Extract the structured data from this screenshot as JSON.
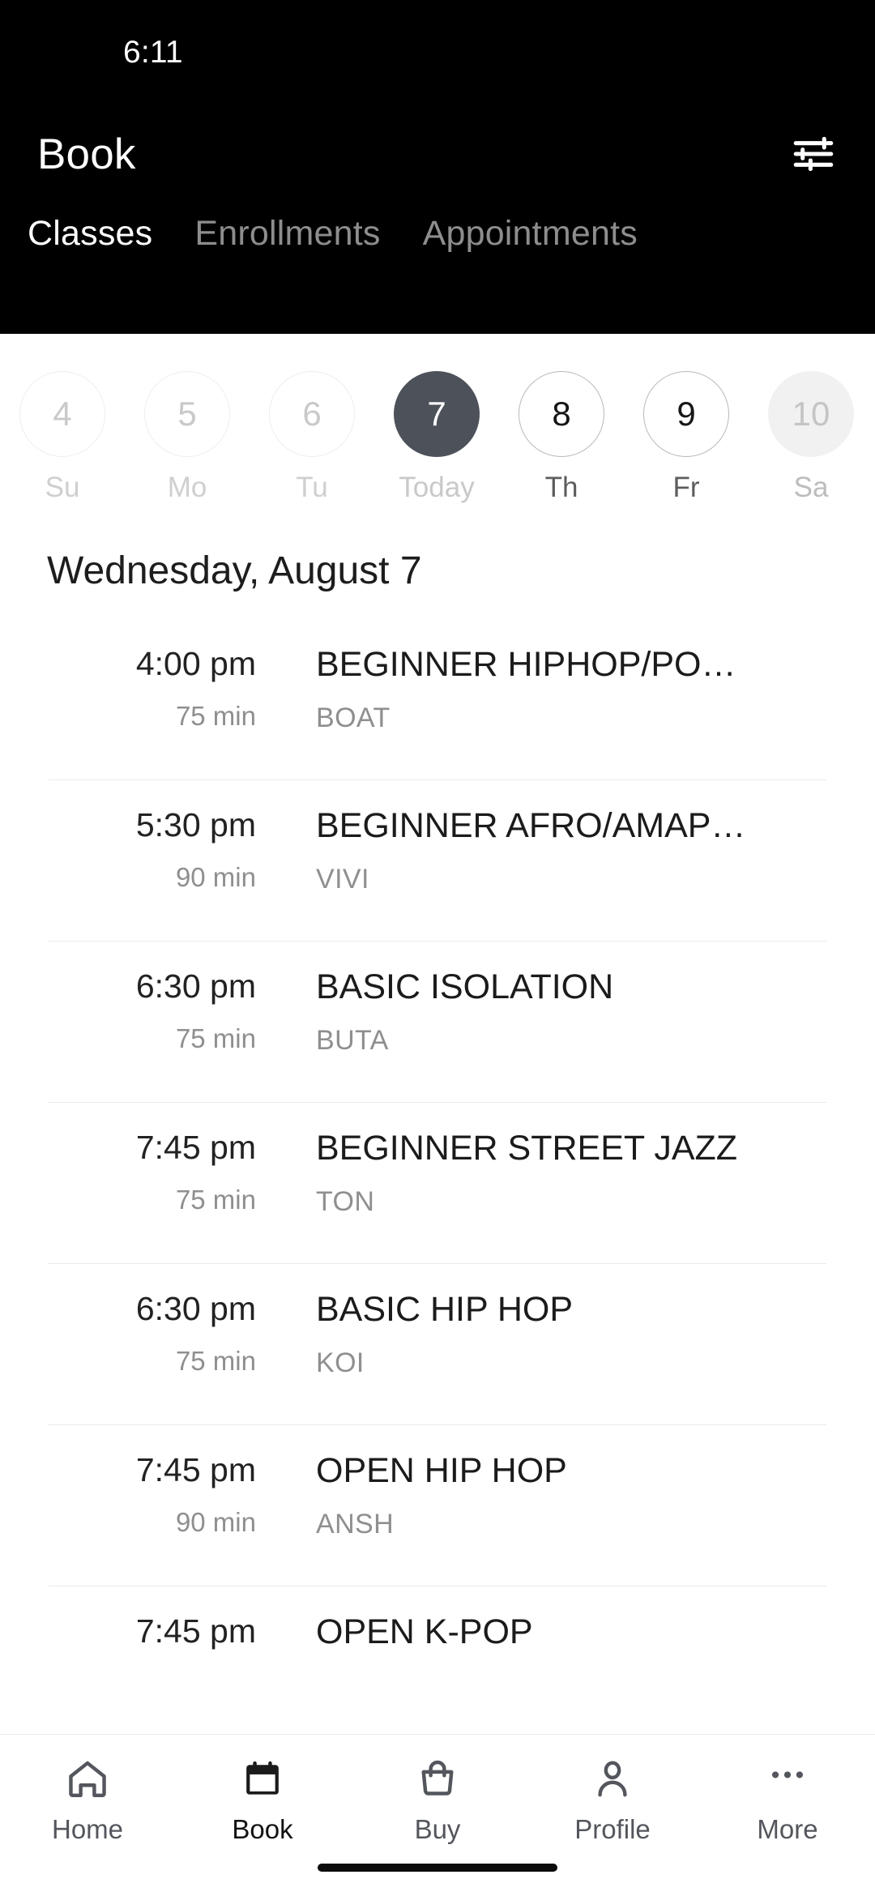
{
  "status_bar": {
    "time": "6:11"
  },
  "header": {
    "title": "Book",
    "filter_icon": "tune-icon",
    "tabs": [
      {
        "label": "Classes",
        "active": true
      },
      {
        "label": "Enrollments",
        "active": false
      },
      {
        "label": "Appointments",
        "active": false
      }
    ]
  },
  "date_strip": {
    "days": [
      {
        "num": "4",
        "weekday": "Su",
        "state": "past"
      },
      {
        "num": "5",
        "weekday": "Mo",
        "state": "past"
      },
      {
        "num": "6",
        "weekday": "Tu",
        "state": "past"
      },
      {
        "num": "7",
        "weekday": "Today",
        "state": "selected"
      },
      {
        "num": "8",
        "weekday": "Th",
        "state": "future"
      },
      {
        "num": "9",
        "weekday": "Fr",
        "state": "future"
      },
      {
        "num": "10",
        "weekday": "Sa",
        "state": "muted-fill"
      }
    ]
  },
  "schedule": {
    "date_heading": "Wednesday, August 7",
    "classes": [
      {
        "time": "4:00 pm",
        "duration": "75 min",
        "name": "BEGINNER HIPHOP/PO…",
        "instructor": "BOAT"
      },
      {
        "time": "5:30 pm",
        "duration": "90 min",
        "name": "BEGINNER AFRO/AMAP…",
        "instructor": "VIVI"
      },
      {
        "time": "6:30 pm",
        "duration": "75 min",
        "name": "BASIC ISOLATION",
        "instructor": "BUTA"
      },
      {
        "time": "7:45 pm",
        "duration": "75 min",
        "name": "BEGINNER STREET JAZZ",
        "instructor": "TON"
      },
      {
        "time": "6:30 pm",
        "duration": "75 min",
        "name": "BASIC HIP HOP",
        "instructor": "KOI"
      },
      {
        "time": "7:45 pm",
        "duration": "90 min",
        "name": "OPEN HIP HOP",
        "instructor": "ANSH"
      },
      {
        "time": "7:45 pm",
        "duration": "",
        "name": "OPEN K-POP",
        "instructor": ""
      }
    ]
  },
  "bottom_nav": {
    "items": [
      {
        "label": "Home",
        "icon": "home-icon",
        "active": false
      },
      {
        "label": "Book",
        "icon": "calendar-icon",
        "active": true
      },
      {
        "label": "Buy",
        "icon": "bag-icon",
        "active": false
      },
      {
        "label": "Profile",
        "icon": "person-icon",
        "active": false
      },
      {
        "label": "More",
        "icon": "ellipsis-icon",
        "active": false
      }
    ]
  },
  "colors": {
    "header_bg": "#000000",
    "selected_day_bg": "#4D515A",
    "page_bg": "#FFFFFF",
    "muted_text": "#8F8F8F",
    "divider": "#EAEAEA"
  }
}
